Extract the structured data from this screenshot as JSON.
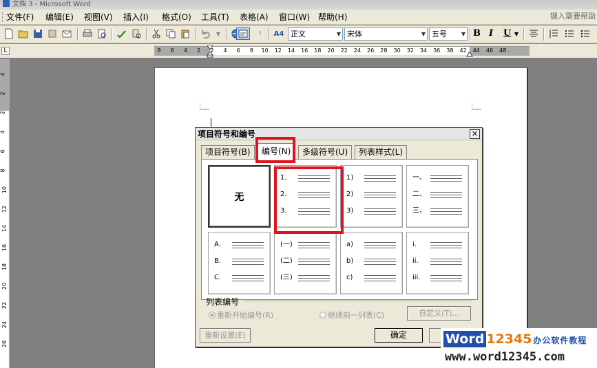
{
  "window": {
    "title": "文档 3 - Microsoft Word"
  },
  "menubar": {
    "items": [
      "文件(F)",
      "编辑(E)",
      "视图(V)",
      "插入(I)",
      "格式(O)",
      "工具(T)",
      "表格(A)",
      "窗口(W)",
      "帮助(H)"
    ],
    "help_placeholder": "键入需要帮助"
  },
  "toolbar": {
    "style_value": "正文",
    "font_value": "宋体",
    "size_value": "五号",
    "bold_label": "B",
    "italic_label": "I",
    "underline_label": "U",
    "style_icon_label": "A4"
  },
  "ruler": {
    "corner_label": "L",
    "h_ticks": [
      "8",
      "6",
      "4",
      "2",
      "2",
      "4",
      "6",
      "8",
      "10",
      "12",
      "14",
      "16",
      "18",
      "20",
      "22",
      "24",
      "26",
      "28",
      "30",
      "32",
      "34",
      "36",
      "38",
      "42",
      "44",
      "46",
      "48"
    ],
    "v_ticks": [
      "4",
      "2",
      "2",
      "4",
      "6",
      "8",
      "10",
      "12",
      "14",
      "16",
      "18",
      "20",
      "22",
      "24",
      "26"
    ]
  },
  "dialog": {
    "title": "项目符号和编号",
    "close_label": "×",
    "tabs": [
      "项目符号(B)",
      "编号(N)",
      "多级符号(U)",
      "列表样式(L)"
    ],
    "active_tab": 1,
    "none_label": "无",
    "options": [
      [
        "1.",
        "2.",
        "3."
      ],
      [
        "1)",
        "2)",
        "3)"
      ],
      [
        "一、",
        "二、",
        "三、"
      ],
      [
        "A.",
        "B.",
        "C."
      ],
      [
        "(一)",
        "(二)",
        "(三)"
      ],
      [
        "a)",
        "b)",
        "c)"
      ],
      [
        "i.",
        "ii.",
        "iii."
      ]
    ],
    "list_numbering_label": "列表编号",
    "restart_label": "重新开始编号(R)",
    "continue_label": "继续前一列表(C)",
    "customize_label": "自定义(T)...",
    "reset_label": "重新设置(E)",
    "ok_label": "确定"
  },
  "watermark": {
    "word": "Word",
    "number": "12345",
    "tagline": "办公软件教程",
    "url": "www.word12345.com"
  },
  "colors": {
    "highlight": "#e0121e",
    "app_bg": "#808080",
    "toolbar_bg": "#ece9d8"
  }
}
